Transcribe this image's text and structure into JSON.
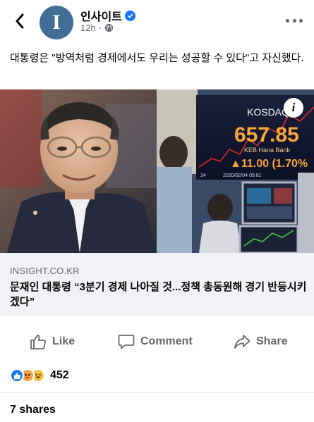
{
  "header": {
    "back_icon": "chevron-left-icon",
    "avatar_letter": "I",
    "page_name": "인사이트",
    "verified_icon": "verified-badge-icon",
    "time": "12h",
    "separator": "·",
    "privacy_icon": "globe-icon",
    "more_icon": "more-horizontal-icon"
  },
  "post": {
    "text": "대통령은 \"방역처럼 경제에서도 우리는 성공할 수 있다\"고 자신했다."
  },
  "link": {
    "image_overlay": {
      "ticker_label": "KOSDAQ",
      "index_value": "657.85",
      "change": "▲11.00 (1.70%",
      "bank_label": "KEB Hana Bank",
      "date_text": "2020/02/04 09:01",
      "screen_prefix": "24"
    },
    "info_icon": "info-icon",
    "info_letter": "i",
    "domain": "INSIGHT.CO.KR",
    "title": "문재인 대통령 “3분기 경제 나아질 것...정책 총동원해 경기 반등시키겠다”"
  },
  "actions": [
    {
      "label": "Like",
      "icon": "thumbs-up-icon"
    },
    {
      "label": "Comment",
      "icon": "comment-icon"
    },
    {
      "label": "Share",
      "icon": "share-icon"
    }
  ],
  "reactions": {
    "icons": [
      "like-reaction-icon",
      "angry-reaction-icon",
      "haha-reaction-icon"
    ],
    "count": "452"
  },
  "shares": "7 shares",
  "colors": {
    "accent": "#1877f2",
    "secondary_text": "#65676b",
    "preview_bg": "#f0f2f5",
    "avatar_bg": "#3f6d95"
  }
}
